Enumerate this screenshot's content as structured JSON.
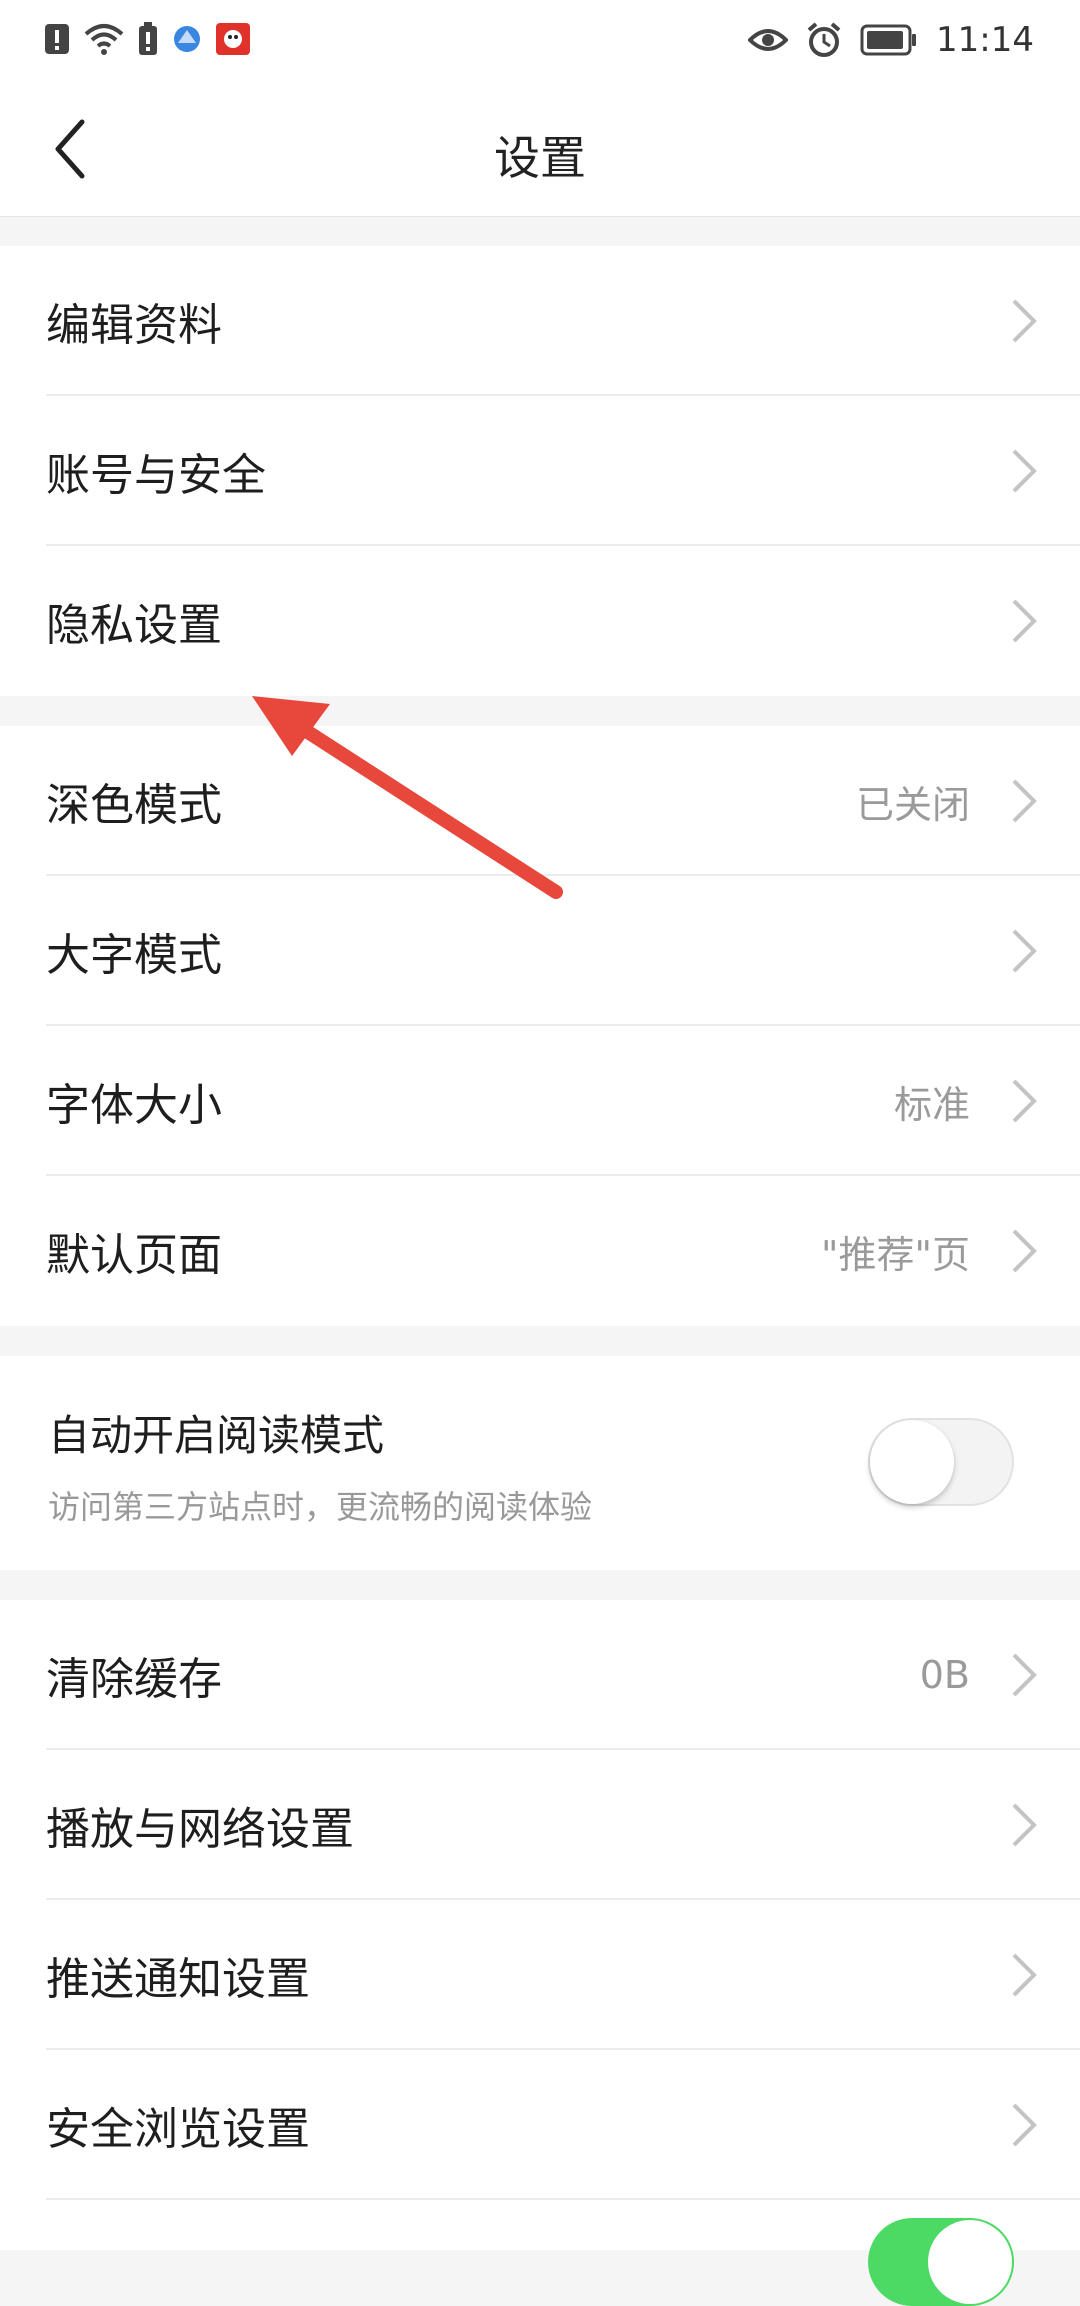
{
  "status_bar": {
    "time": "11:14",
    "left_icons": [
      "notification-alert-icon",
      "wifi-icon",
      "battery-alert-icon",
      "browser-icon",
      "app-icon"
    ],
    "right_icons": [
      "eye-icon",
      "alarm-icon",
      "battery-icon"
    ]
  },
  "header": {
    "title": "设置",
    "back_icon": "back-chevron-icon"
  },
  "groups": [
    {
      "items": [
        {
          "label": "编辑资料",
          "value": ""
        },
        {
          "label": "账号与安全",
          "value": ""
        },
        {
          "label": "隐私设置",
          "value": ""
        }
      ]
    },
    {
      "items": [
        {
          "label": "深色模式",
          "value": "已关闭"
        },
        {
          "label": "大字模式",
          "value": ""
        },
        {
          "label": "字体大小",
          "value": "标准"
        },
        {
          "label": "默认页面",
          "value": "\"推荐\"页"
        }
      ]
    },
    {
      "toggle": {
        "title": "自动开启阅读模式",
        "subtitle": "访问第三方站点时，更流畅的阅读体验",
        "on": false
      }
    },
    {
      "items": [
        {
          "label": "清除缓存",
          "value": "0B"
        },
        {
          "label": "播放与网络设置",
          "value": ""
        },
        {
          "label": "推送通知设置",
          "value": ""
        },
        {
          "label": "安全浏览设置",
          "value": ""
        }
      ]
    }
  ],
  "annotation": {
    "arrow_color": "#e8473b",
    "points_to": "隐私设置"
  },
  "colors": {
    "toggle_on": "#4cd964",
    "separator": "#f5f5f5"
  }
}
